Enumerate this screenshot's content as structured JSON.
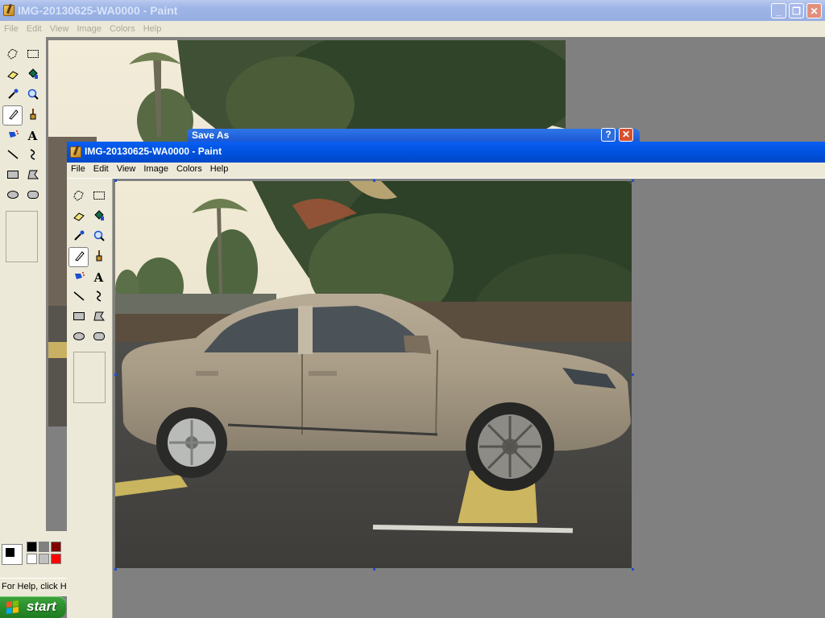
{
  "back_window": {
    "title": "IMG-20130625-WA0000 - Paint",
    "menu": [
      "File",
      "Edit",
      "View",
      "Image",
      "Colors",
      "Help"
    ],
    "status_text": "For Help, click Help Topics on the Help Menu."
  },
  "dialog": {
    "title": "Save As"
  },
  "front_window": {
    "title": "IMG-20130625-WA0000 - Paint",
    "menu": [
      "File",
      "Edit",
      "View",
      "Image",
      "Colors",
      "Help"
    ]
  },
  "tools": [
    {
      "name": "free-form-select",
      "icon": "free-select-icon"
    },
    {
      "name": "select",
      "icon": "rect-select-icon"
    },
    {
      "name": "eraser",
      "icon": "eraser-icon"
    },
    {
      "name": "fill",
      "icon": "fill-bucket-icon"
    },
    {
      "name": "pick-color",
      "icon": "eyedropper-icon"
    },
    {
      "name": "magnifier",
      "icon": "magnifier-icon"
    },
    {
      "name": "pencil",
      "icon": "pencil-icon",
      "selected": true
    },
    {
      "name": "brush",
      "icon": "brush-icon"
    },
    {
      "name": "airbrush",
      "icon": "airbrush-icon"
    },
    {
      "name": "text",
      "icon": "text-icon",
      "glyph": "A"
    },
    {
      "name": "line",
      "icon": "line-icon"
    },
    {
      "name": "curve",
      "icon": "curve-icon"
    },
    {
      "name": "rectangle",
      "icon": "rectangle-icon"
    },
    {
      "name": "polygon",
      "icon": "polygon-icon"
    },
    {
      "name": "ellipse",
      "icon": "ellipse-icon"
    },
    {
      "name": "rounded-rectangle",
      "icon": "rounded-rect-icon"
    }
  ],
  "palette": {
    "foreground": "#000000",
    "background": "#ffffff",
    "colors": [
      "#000000",
      "#808080",
      "#800000",
      "#ffffff",
      "#c0c0c0",
      "#ff0000"
    ]
  },
  "taskbar": {
    "start_label": "start"
  }
}
